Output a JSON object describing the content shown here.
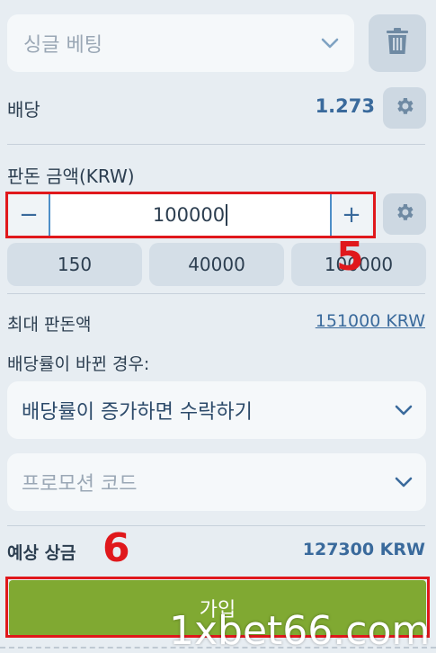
{
  "bet_type": {
    "label": "싱글 베팅",
    "icon": "chevron-down-icon"
  },
  "delete": {
    "icon": "trash-icon"
  },
  "odds": {
    "label": "배당",
    "value": "1.273",
    "settings_icon": "gear-icon"
  },
  "stake": {
    "label": "판돈 금액(KRW)",
    "minus": "−",
    "value": "100000",
    "plus": "+",
    "settings_icon": "gear-icon",
    "quick_amounts": [
      "150",
      "40000",
      "100000"
    ]
  },
  "markers": {
    "stake": "5",
    "submit": "6"
  },
  "max_stake": {
    "label": "최대 판돈액",
    "value": "151000 KRW"
  },
  "odds_change": {
    "label": "배당률이 바뀐 경우:",
    "selected": "배당률이 증가하면 수락하기"
  },
  "promo": {
    "placeholder": "프로모션 코드"
  },
  "payout": {
    "label": "예상 상금",
    "value": "127300 KRW"
  },
  "submit": {
    "label": "가입"
  },
  "watermark": "1xbet66.com",
  "colors": {
    "accent": "#3a6a9c",
    "submit": "#80a932",
    "highlight": "#e0181c",
    "background": "#e7edf2"
  }
}
